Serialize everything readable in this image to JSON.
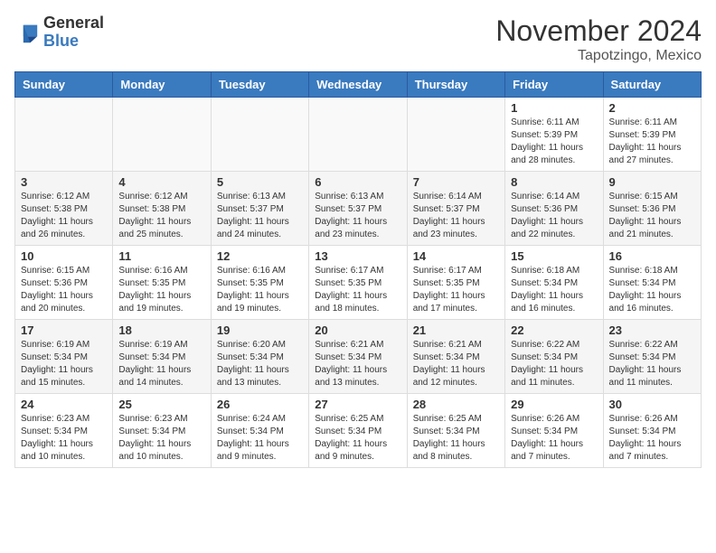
{
  "header": {
    "logo_general": "General",
    "logo_blue": "Blue",
    "month": "November 2024",
    "location": "Tapotzingo, Mexico"
  },
  "days_of_week": [
    "Sunday",
    "Monday",
    "Tuesday",
    "Wednesday",
    "Thursday",
    "Friday",
    "Saturday"
  ],
  "weeks": [
    [
      {
        "day": "",
        "info": ""
      },
      {
        "day": "",
        "info": ""
      },
      {
        "day": "",
        "info": ""
      },
      {
        "day": "",
        "info": ""
      },
      {
        "day": "",
        "info": ""
      },
      {
        "day": "1",
        "info": "Sunrise: 6:11 AM\nSunset: 5:39 PM\nDaylight: 11 hours\nand 28 minutes."
      },
      {
        "day": "2",
        "info": "Sunrise: 6:11 AM\nSunset: 5:39 PM\nDaylight: 11 hours\nand 27 minutes."
      }
    ],
    [
      {
        "day": "3",
        "info": "Sunrise: 6:12 AM\nSunset: 5:38 PM\nDaylight: 11 hours\nand 26 minutes."
      },
      {
        "day": "4",
        "info": "Sunrise: 6:12 AM\nSunset: 5:38 PM\nDaylight: 11 hours\nand 25 minutes."
      },
      {
        "day": "5",
        "info": "Sunrise: 6:13 AM\nSunset: 5:37 PM\nDaylight: 11 hours\nand 24 minutes."
      },
      {
        "day": "6",
        "info": "Sunrise: 6:13 AM\nSunset: 5:37 PM\nDaylight: 11 hours\nand 23 minutes."
      },
      {
        "day": "7",
        "info": "Sunrise: 6:14 AM\nSunset: 5:37 PM\nDaylight: 11 hours\nand 23 minutes."
      },
      {
        "day": "8",
        "info": "Sunrise: 6:14 AM\nSunset: 5:36 PM\nDaylight: 11 hours\nand 22 minutes."
      },
      {
        "day": "9",
        "info": "Sunrise: 6:15 AM\nSunset: 5:36 PM\nDaylight: 11 hours\nand 21 minutes."
      }
    ],
    [
      {
        "day": "10",
        "info": "Sunrise: 6:15 AM\nSunset: 5:36 PM\nDaylight: 11 hours\nand 20 minutes."
      },
      {
        "day": "11",
        "info": "Sunrise: 6:16 AM\nSunset: 5:35 PM\nDaylight: 11 hours\nand 19 minutes."
      },
      {
        "day": "12",
        "info": "Sunrise: 6:16 AM\nSunset: 5:35 PM\nDaylight: 11 hours\nand 19 minutes."
      },
      {
        "day": "13",
        "info": "Sunrise: 6:17 AM\nSunset: 5:35 PM\nDaylight: 11 hours\nand 18 minutes."
      },
      {
        "day": "14",
        "info": "Sunrise: 6:17 AM\nSunset: 5:35 PM\nDaylight: 11 hours\nand 17 minutes."
      },
      {
        "day": "15",
        "info": "Sunrise: 6:18 AM\nSunset: 5:34 PM\nDaylight: 11 hours\nand 16 minutes."
      },
      {
        "day": "16",
        "info": "Sunrise: 6:18 AM\nSunset: 5:34 PM\nDaylight: 11 hours\nand 16 minutes."
      }
    ],
    [
      {
        "day": "17",
        "info": "Sunrise: 6:19 AM\nSunset: 5:34 PM\nDaylight: 11 hours\nand 15 minutes."
      },
      {
        "day": "18",
        "info": "Sunrise: 6:19 AM\nSunset: 5:34 PM\nDaylight: 11 hours\nand 14 minutes."
      },
      {
        "day": "19",
        "info": "Sunrise: 6:20 AM\nSunset: 5:34 PM\nDaylight: 11 hours\nand 13 minutes."
      },
      {
        "day": "20",
        "info": "Sunrise: 6:21 AM\nSunset: 5:34 PM\nDaylight: 11 hours\nand 13 minutes."
      },
      {
        "day": "21",
        "info": "Sunrise: 6:21 AM\nSunset: 5:34 PM\nDaylight: 11 hours\nand 12 minutes."
      },
      {
        "day": "22",
        "info": "Sunrise: 6:22 AM\nSunset: 5:34 PM\nDaylight: 11 hours\nand 11 minutes."
      },
      {
        "day": "23",
        "info": "Sunrise: 6:22 AM\nSunset: 5:34 PM\nDaylight: 11 hours\nand 11 minutes."
      }
    ],
    [
      {
        "day": "24",
        "info": "Sunrise: 6:23 AM\nSunset: 5:34 PM\nDaylight: 11 hours\nand 10 minutes."
      },
      {
        "day": "25",
        "info": "Sunrise: 6:23 AM\nSunset: 5:34 PM\nDaylight: 11 hours\nand 10 minutes."
      },
      {
        "day": "26",
        "info": "Sunrise: 6:24 AM\nSunset: 5:34 PM\nDaylight: 11 hours\nand 9 minutes."
      },
      {
        "day": "27",
        "info": "Sunrise: 6:25 AM\nSunset: 5:34 PM\nDaylight: 11 hours\nand 9 minutes."
      },
      {
        "day": "28",
        "info": "Sunrise: 6:25 AM\nSunset: 5:34 PM\nDaylight: 11 hours\nand 8 minutes."
      },
      {
        "day": "29",
        "info": "Sunrise: 6:26 AM\nSunset: 5:34 PM\nDaylight: 11 hours\nand 7 minutes."
      },
      {
        "day": "30",
        "info": "Sunrise: 6:26 AM\nSunset: 5:34 PM\nDaylight: 11 hours\nand 7 minutes."
      }
    ]
  ]
}
